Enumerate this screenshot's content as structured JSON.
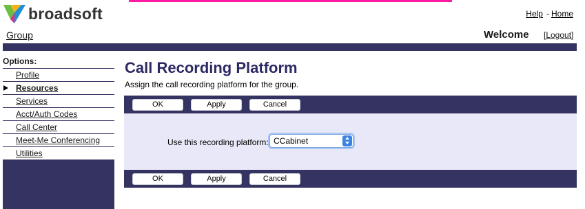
{
  "brand": {
    "logo_text": "broadsoft",
    "logo_colors": [
      "#6cbf3e",
      "#f6b21a",
      "#1f8fd8",
      "#e62b8a"
    ],
    "accent_color": "#ff1aa8",
    "nav_color": "#343362"
  },
  "header": {
    "help_label": "Help",
    "separator": "-",
    "home_label": "Home",
    "group_label": "Group",
    "welcome_label": "Welcome",
    "logout_label": "[Logout]"
  },
  "sidebar": {
    "title": "Options:",
    "items": [
      {
        "label": "Profile",
        "active": false
      },
      {
        "label": "Resources",
        "active": true
      },
      {
        "label": "Services",
        "active": false
      },
      {
        "label": "Acct/Auth Codes",
        "active": false
      },
      {
        "label": "Call Center",
        "active": false
      },
      {
        "label": "Meet-Me Conferencing",
        "active": false
      },
      {
        "label": "Utilities",
        "active": false
      }
    ]
  },
  "main": {
    "title": "Call Recording Platform",
    "subtitle": "Assign the call recording platform for the group.",
    "buttons": {
      "ok": "OK",
      "apply": "Apply",
      "cancel": "Cancel"
    },
    "form": {
      "platform_label": "Use this recording platform:",
      "platform_value": "CCabinet"
    }
  }
}
